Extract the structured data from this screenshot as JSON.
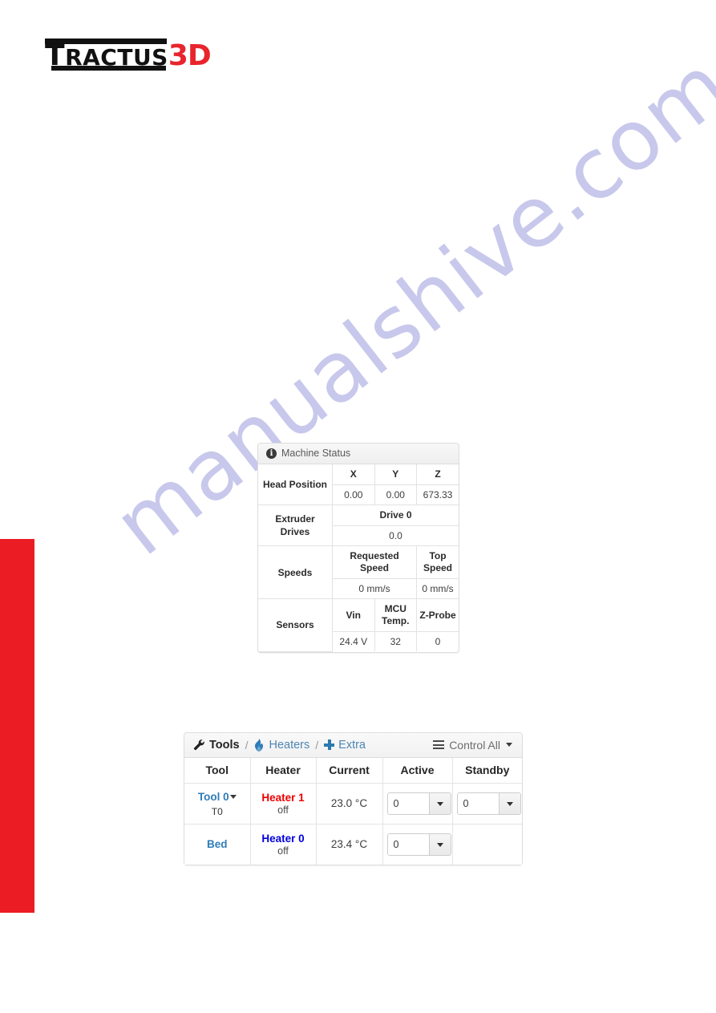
{
  "brand": {
    "logo_primary": "TRACTUS",
    "logo_primary_first": "T",
    "logo_primary_rest": "RACTUS",
    "logo_accent": "3D",
    "accent_color": "#e8252c",
    "sidebar_color": "#ec1c24"
  },
  "watermark": {
    "text": "manualshive.com",
    "color": "#bcbce8"
  },
  "machine_status": {
    "title": "Machine Status",
    "info_icon": "info-icon",
    "head_position": {
      "label": "Head Position",
      "columns": [
        "X",
        "Y",
        "Z"
      ],
      "values": [
        "0.00",
        "0.00",
        "673.33"
      ]
    },
    "extruder_drives": {
      "label": "Extruder Drives",
      "columns": [
        "Drive 0"
      ],
      "values": [
        "0.0"
      ]
    },
    "speeds": {
      "label": "Speeds",
      "columns": [
        "Requested Speed",
        "Top Speed"
      ],
      "values": [
        "0 mm/s",
        "0 mm/s"
      ]
    },
    "sensors": {
      "label": "Sensors",
      "columns": [
        "Vin",
        "MCU Temp.",
        "Z-Probe"
      ],
      "values": [
        "24.4 V",
        "32",
        "0"
      ]
    }
  },
  "tools_panel": {
    "header": {
      "tools_label": "Tools",
      "tools_icon": "wrench-icon",
      "separator": "/",
      "heaters_label": "Heaters",
      "heaters_icon": "flame-icon",
      "extra_label": "Extra",
      "extra_icon": "plus-icon",
      "control_all_label": "Control All",
      "control_all_icon": "hamburger-icon"
    },
    "columns": [
      "Tool",
      "Heater",
      "Current",
      "Active",
      "Standby"
    ],
    "rows": [
      {
        "tool_name": "Tool 0",
        "tool_sub": "T0",
        "tool_has_caret": true,
        "heater_name": "Heater 1",
        "heater_color": "red",
        "heater_state": "off",
        "current": "23.0 °C",
        "active_value": "0",
        "standby_value": "0",
        "has_standby": true
      },
      {
        "tool_name": "Bed",
        "tool_sub": "",
        "tool_has_caret": false,
        "heater_name": "Heater 0",
        "heater_color": "blue",
        "heater_state": "off",
        "current": "23.4 °C",
        "active_value": "0",
        "standby_value": "",
        "has_standby": false
      }
    ]
  }
}
